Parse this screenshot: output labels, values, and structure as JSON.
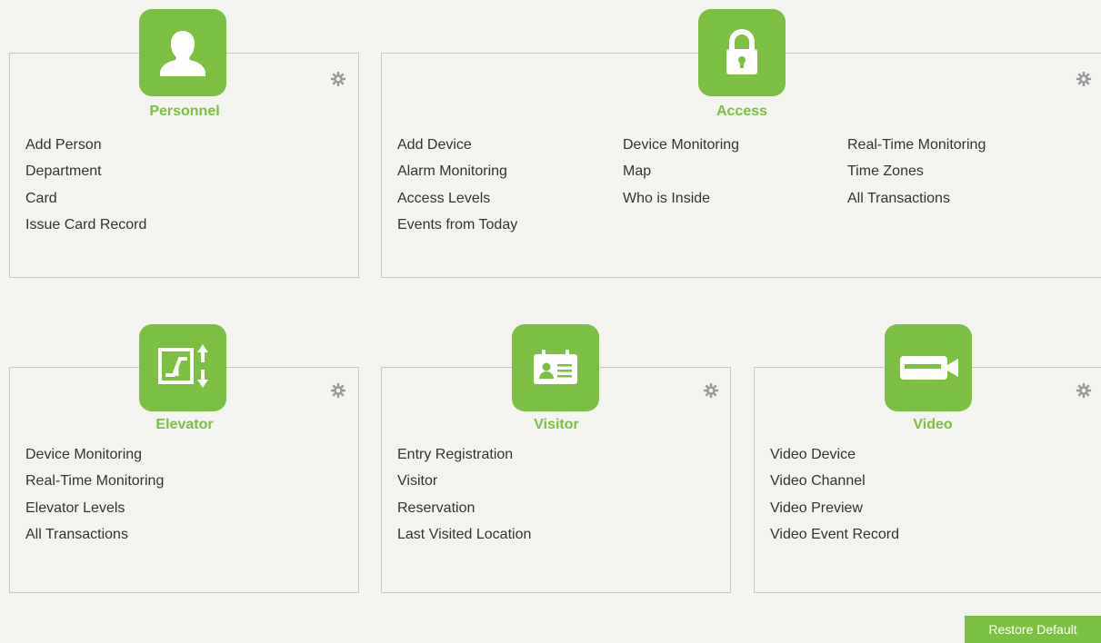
{
  "colors": {
    "accent": "#7bc043",
    "background": "#f3f3ef",
    "border": "#c8c8c8",
    "text": "#333333",
    "gear": "#9a9a9a"
  },
  "panels": {
    "personnel": {
      "title": "Personnel",
      "icon": "person-icon",
      "items": [
        "Add Person",
        "Department",
        "Card",
        "Issue Card Record"
      ]
    },
    "access": {
      "title": "Access",
      "icon": "lock-icon",
      "columns": [
        [
          "Add Device",
          "Alarm Monitoring",
          "Access Levels",
          "Events from Today"
        ],
        [
          "Device Monitoring",
          "Map",
          "Who is Inside"
        ],
        [
          "Real-Time Monitoring",
          "Time Zones",
          "All Transactions"
        ]
      ]
    },
    "elevator": {
      "title": "Elevator",
      "icon": "elevator-icon",
      "items": [
        "Device Monitoring",
        "Real-Time Monitoring",
        "Elevator Levels",
        "All Transactions"
      ]
    },
    "visitor": {
      "title": "Visitor",
      "icon": "visitor-badge-icon",
      "items": [
        "Entry Registration",
        "Visitor",
        "Reservation",
        "Last Visited Location"
      ]
    },
    "video": {
      "title": "Video",
      "icon": "video-camera-icon",
      "items": [
        "Video Device",
        "Video Channel",
        "Video Preview",
        "Video Event Record"
      ]
    }
  },
  "footer": {
    "restore_label": "Restore Default"
  }
}
